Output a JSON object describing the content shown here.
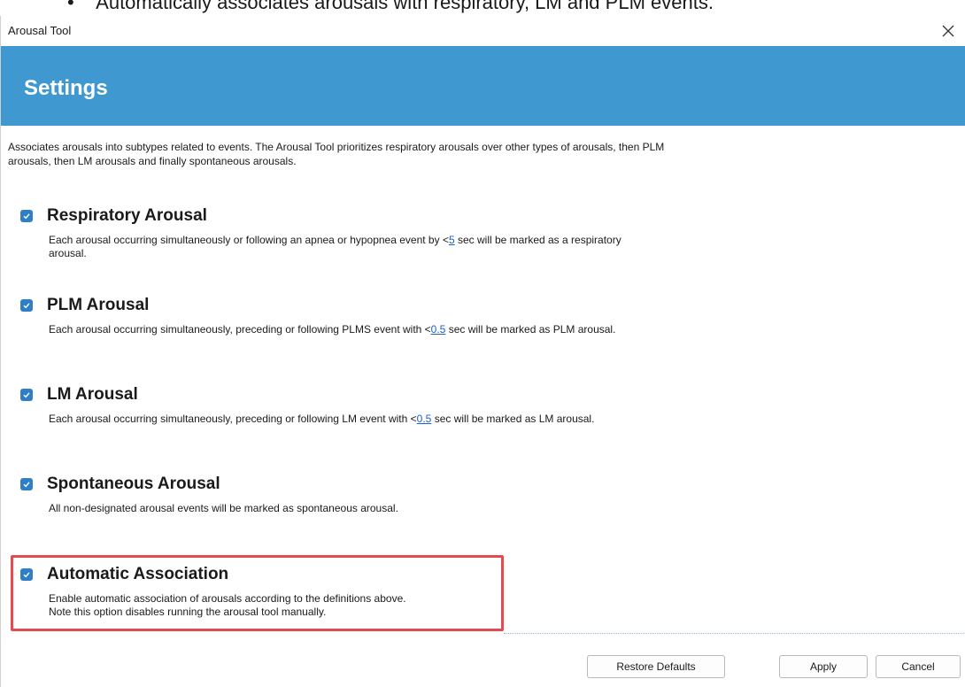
{
  "document": {
    "bullet_text": "Automatically associates arousals with respiratory, LM and PLM events."
  },
  "window": {
    "title": "Arousal Tool",
    "close_glyph": "×"
  },
  "banner": {
    "title": "Settings",
    "color": "#3f98cf"
  },
  "intro_text": "Associates arousals into subtypes related to events. The Arousal Tool prioritizes respiratory arousals over other types of arousals, then PLM arousals, then LM arousals and finally spontaneous arousals.",
  "options": {
    "respiratory": {
      "checked": true,
      "title": "Respiratory Arousal",
      "desc_before": "Each arousal occurring simultaneously or following an apnea or hypopnea event by <",
      "link_value": "5",
      "desc_after": " sec will be marked as a respiratory arousal."
    },
    "plm": {
      "checked": true,
      "title": "PLM Arousal",
      "desc_before": "Each arousal occurring simultaneously, preceding or following PLMS event with <",
      "link_value": "0.5",
      "desc_after": " sec will be marked as PLM arousal."
    },
    "lm": {
      "checked": true,
      "title": "LM Arousal",
      "desc_before": "Each arousal occurring simultaneously, preceding or following LM event with <",
      "link_value": "0.5",
      "desc_after": " sec will be marked as LM arousal."
    },
    "spontaneous": {
      "checked": true,
      "title": "Spontaneous Arousal",
      "desc": "All non-designated arousal events will be marked as spontaneous arousal."
    },
    "automatic": {
      "checked": true,
      "title": "Automatic Association",
      "desc_line1": "Enable automatic association of arousals according to the definitions above.",
      "desc_line2": "Note this option disables running the arousal tool manually."
    }
  },
  "buttons": {
    "restore_defaults": "Restore Defaults",
    "apply": "Apply",
    "cancel": "Cancel"
  },
  "colors": {
    "checkbox": "#2f7fc6",
    "highlight": "#e24b50",
    "link": "#1a5fd6"
  },
  "icons": {
    "checkbox": "checkmark-icon",
    "close": "close-icon"
  }
}
